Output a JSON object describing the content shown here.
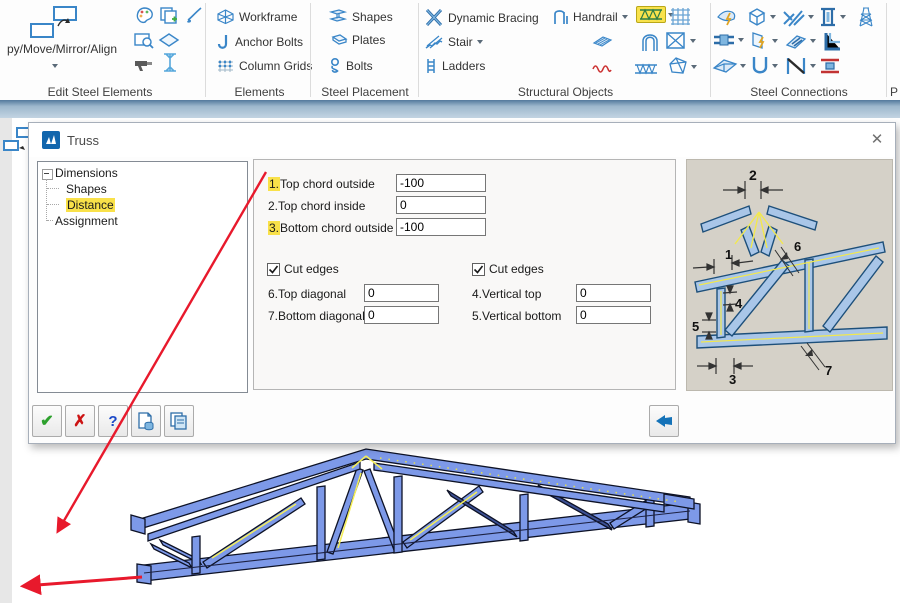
{
  "colors": {
    "accent_yellow": "#f9e149",
    "steel_blue": "#7d99e8",
    "annotation_red": "#e8192c",
    "icon_blue": "#3a86c8"
  },
  "ribbon": {
    "edit_group": {
      "label": "Edit Steel Elements",
      "big_button_label": "py/Move/Mirror/Align"
    },
    "elements_group": {
      "label": "Elements",
      "workframe": "Workframe",
      "anchor_bolts": "Anchor Bolts",
      "column_grids": "Column Grids"
    },
    "placement_group": {
      "label": "Steel Placement",
      "shapes": "Shapes",
      "plates": "Plates",
      "bolts": "Bolts"
    },
    "structural_group": {
      "label": "Structural Objects",
      "dynamic_bracing": "Dynamic Bracing",
      "stair": "Stair",
      "ladders": "Ladders",
      "handrail": "Handrail"
    },
    "connections_group": {
      "label": "Steel Connections"
    },
    "partial_group": {
      "label": "P"
    }
  },
  "dialog": {
    "title": "Truss",
    "close_glyph": "✕",
    "tree": {
      "dimensions": "Dimensions",
      "shapes": "Shapes",
      "distance": "Distance",
      "assignment": "Assignment"
    },
    "form": {
      "row1": {
        "num": "1.",
        "label": "Top chord outside",
        "value": "-100"
      },
      "row2": {
        "label": "2.Top chord inside",
        "value": "0"
      },
      "row3": {
        "num": "3.",
        "label": "Bottom chord outside",
        "value": "-100"
      },
      "cut_edges_left": "Cut edges",
      "cut_edges_right": "Cut edges",
      "row6": {
        "label": "6.Top diagonal",
        "value": "0"
      },
      "row7": {
        "label": "7.Bottom diagonal",
        "value": "0"
      },
      "row4": {
        "label": "4.Vertical top",
        "value": "0"
      },
      "row5": {
        "label": "5.Vertical bottom",
        "value": "0"
      }
    },
    "preview": {
      "n1": "1",
      "n2": "2",
      "n3": "3",
      "n4": "4",
      "n5": "5",
      "n6": "6",
      "n7": "7"
    },
    "toolbar": {
      "ok_glyph": "✔",
      "cancel_glyph": "✗",
      "help_glyph": "?"
    }
  }
}
